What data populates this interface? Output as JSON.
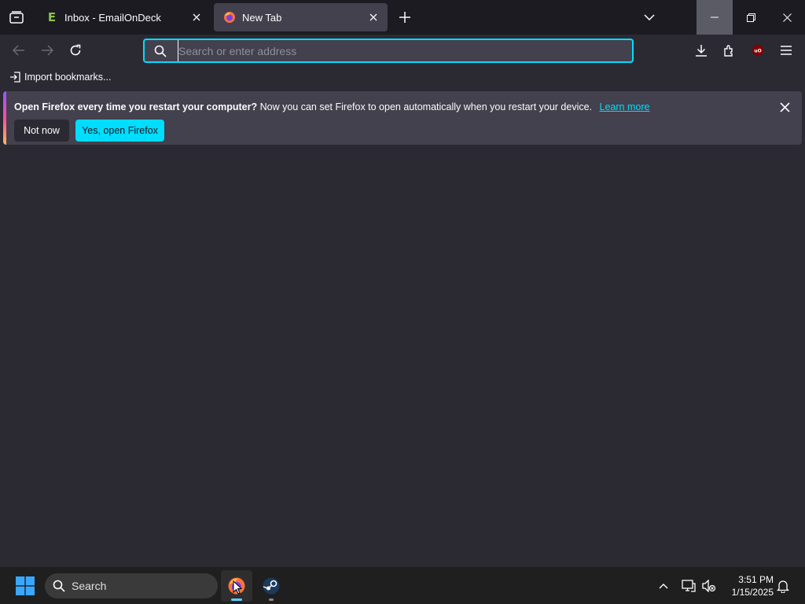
{
  "tabs": [
    {
      "title": "Inbox - EmailOnDeck",
      "favicon": "E"
    },
    {
      "title": "New Tab"
    }
  ],
  "urlbar": {
    "placeholder": "Search or enter address"
  },
  "bookmarks": {
    "import_label": "Import bookmarks..."
  },
  "notification": {
    "bold": "Open Firefox every time you restart your computer?",
    "message": "Now you can set Firefox to open automatically when you restart your device.",
    "link": "Learn more",
    "secondary_button": "Not now",
    "primary_button": "Yes, open Firefox"
  },
  "taskbar": {
    "search_label": "Search",
    "time": "3:51 PM",
    "date": "1/15/2025"
  },
  "colors": {
    "accent": "#00ddff",
    "toolbar": "#2b2a33",
    "tabstrip": "#1c1b22",
    "selected_tab": "#42414d"
  },
  "icons": [
    "tab-list-icon",
    "firefox-icon",
    "close-icon",
    "plus-icon",
    "chevron-down-icon",
    "minimize-icon",
    "restore-icon",
    "back-icon",
    "forward-icon",
    "reload-icon",
    "search-icon",
    "download-icon",
    "extensions-icon",
    "ublock-icon",
    "menu-icon",
    "import-icon",
    "windows-logo-icon",
    "steam-icon",
    "chevron-up-icon",
    "network-icon",
    "volume-muted-icon",
    "bell-icon"
  ]
}
